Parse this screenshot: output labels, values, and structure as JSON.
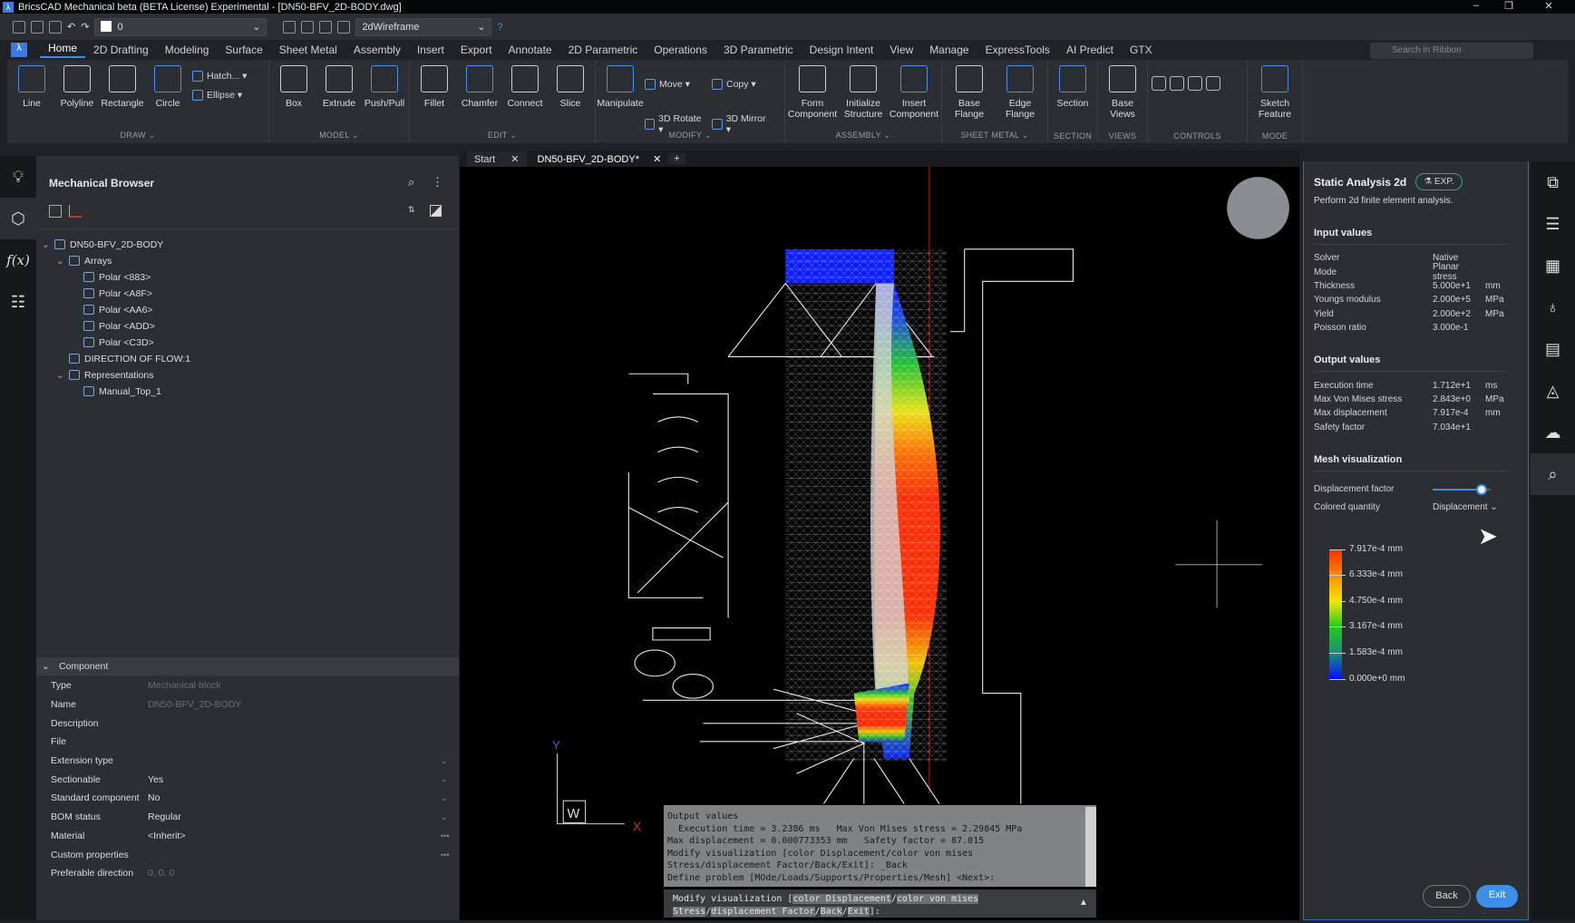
{
  "window": {
    "title": "BricsCAD Mechanical beta (BETA License) Experimental - [DN50-BFV_2D-BODY.dwg]",
    "minimize": "–",
    "restore": "❐",
    "close": "✕"
  },
  "qat": {
    "layer": "0",
    "visual_style": "2dWireframe"
  },
  "ribbon_tabs": [
    "Home",
    "2D Drafting",
    "Modeling",
    "Surface",
    "Sheet Metal",
    "Assembly",
    "Insert",
    "Export",
    "Annotate",
    "2D Parametric",
    "Operations",
    "3D Parametric",
    "Design Intent",
    "View",
    "Manage",
    "ExpressTools",
    "AI Predict",
    "GTX"
  ],
  "active_tab": "Home",
  "search_placeholder": "Search in Ribbon",
  "ribbon_groups": [
    {
      "label": "DRAW ⌄",
      "tools": [
        "Line",
        "Polyline",
        "Rectangle",
        "Circle"
      ],
      "small": [
        "Hatch... ▾",
        "Ellipse ▾"
      ]
    },
    {
      "label": "MODEL ⌄",
      "tools": [
        "Box",
        "Extrude",
        "Push/Pull"
      ]
    },
    {
      "label": "EDIT ⌄",
      "tools": [
        "Fillet",
        "Chamfer",
        "Connect",
        "Slice"
      ]
    },
    {
      "label": "MODIFY ⌄",
      "tools": [
        "Manipulate"
      ],
      "small": [
        "Move ▾",
        "Copy ▾",
        "3D Rotate ▾",
        "3D Mirror ▾"
      ]
    },
    {
      "label": "ASSEMBLY ⌄",
      "tools": [
        "Form Component",
        "Initialize Structure",
        "Insert Component"
      ]
    },
    {
      "label": "SHEET METAL ⌄",
      "tools": [
        "Base Flange",
        "Edge Flange"
      ]
    },
    {
      "label": "SECTION",
      "tools": [
        "Section"
      ]
    },
    {
      "label": "VIEWS",
      "tools": [
        "Base Views"
      ]
    },
    {
      "label": "CONTROLS",
      "tools": []
    },
    {
      "label": "MODE",
      "tools": [
        "Sketch Feature"
      ]
    }
  ],
  "browser": {
    "title": "Mechanical Browser",
    "tree": [
      {
        "label": "DN50-BFV_2D-BODY",
        "level": 0,
        "expand": "⌄"
      },
      {
        "label": "Arrays",
        "level": 1,
        "expand": "⌄"
      },
      {
        "label": "Polar <883>",
        "level": 2
      },
      {
        "label": "Polar <A8F>",
        "level": 2
      },
      {
        "label": "Polar <AA6>",
        "level": 2
      },
      {
        "label": "Polar <ADD>",
        "level": 2
      },
      {
        "label": "Polar <C3D>",
        "level": 2
      },
      {
        "label": "DIRECTION OF FLOW:1",
        "level": 1
      },
      {
        "label": "Representations",
        "level": 1,
        "expand": "⌄"
      },
      {
        "label": "Manual_Top_1",
        "level": 2
      }
    ]
  },
  "properties": {
    "section": "Component",
    "rows": [
      {
        "k": "Type",
        "v": "Mechanical block",
        "dim": true
      },
      {
        "k": "Name",
        "v": "DN50-BFV_2D-BODY",
        "dim": true
      },
      {
        "k": "Description",
        "v": ""
      },
      {
        "k": "File",
        "v": ""
      },
      {
        "k": "Extension type",
        "v": "",
        "dd": true
      },
      {
        "k": "Sectionable",
        "v": "Yes",
        "dd": true
      },
      {
        "k": "Standard component",
        "v": "No",
        "dd": true
      },
      {
        "k": "BOM status",
        "v": "Regular",
        "dd": true
      },
      {
        "k": "Material",
        "v": " <Inherit>",
        "more": true
      },
      {
        "k": "Custom properties",
        "v": "",
        "more": true
      },
      {
        "k": "Preferable direction",
        "v": "0, 0, 0",
        "dim": true
      }
    ]
  },
  "doc_tabs": {
    "start": "Start",
    "active": "DN50-BFV_2D-BODY*",
    "close": "✕",
    "add": "+"
  },
  "viewport": {
    "ucs_x": "X",
    "ucs_y": "Y",
    "ucs_w": "W"
  },
  "command": {
    "output": [
      "Output values",
      "  Execution time = 3.2386 ms   Max Von Mises stress = 2.29845 MPa",
      "Max displacement = 0.000773353 mm   Safety factor = 87.015",
      "Modify visualization [color Displacement/color von mises",
      "Stress/displacement Factor/Back/Exit]: _Back",
      "Define problem [MOde/Loads/Supports/Properties/Mesh] <Next>:"
    ],
    "prompt_prefix": "Modify visualization [",
    "opt1": "color Displacement",
    "sep1": "/",
    "opt2": "color von mises",
    "opt3": "Stress",
    "sep2": "/",
    "opt4": "displacement Factor",
    "sep3": "/",
    "opt5": "Back",
    "sep4": "/",
    "opt6": "Exit",
    "suffix": "]:"
  },
  "analysis": {
    "title": "Static Analysis 2d",
    "badge": "EXP.",
    "description": "Perform 2d finite element analysis.",
    "input_title": "Input values",
    "inputs": [
      {
        "k": "Solver",
        "v": "Native",
        "u": ""
      },
      {
        "k": "Mode",
        "v": "Planar stress",
        "u": ""
      },
      {
        "k": "Thickness",
        "v": "5.000e+1",
        "u": "mm"
      },
      {
        "k": "Youngs modulus",
        "v": "2.000e+5",
        "u": "MPa"
      },
      {
        "k": "Yield",
        "v": "2.000e+2",
        "u": "MPa"
      },
      {
        "k": "Poisson ratio",
        "v": "3.000e-1",
        "u": ""
      }
    ],
    "output_title": "Output values",
    "outputs": [
      {
        "k": "Execution time",
        "v": "1.712e+1",
        "u": "ms"
      },
      {
        "k": "Max Von Mises stress",
        "v": "2.843e+0",
        "u": "MPa"
      },
      {
        "k": "Max displacement",
        "v": "7.917e-4",
        "u": "mm"
      },
      {
        "k": "Safety factor",
        "v": "7.034e+1",
        "u": ""
      }
    ],
    "mesh_title": "Mesh visualization",
    "disp_factor_label": "Displacement factor",
    "disp_factor_value": 0.85,
    "colored_label": "Colored quantity",
    "colored_value": "Displacement ⌄",
    "legend": [
      "7.917e-4 mm",
      "6.333e-4 mm",
      "4.750e-4 mm",
      "3.167e-4 mm",
      "1.583e-4 mm",
      "0.000e+0 mm"
    ],
    "legend_colors": [
      "#ff2a00",
      "#ff8c00",
      "#f0e800",
      "#22c81e",
      "#1a8f7a",
      "#0010ff"
    ],
    "back": "Back",
    "exit": "Exit",
    "accent": "#3d8ee8"
  }
}
